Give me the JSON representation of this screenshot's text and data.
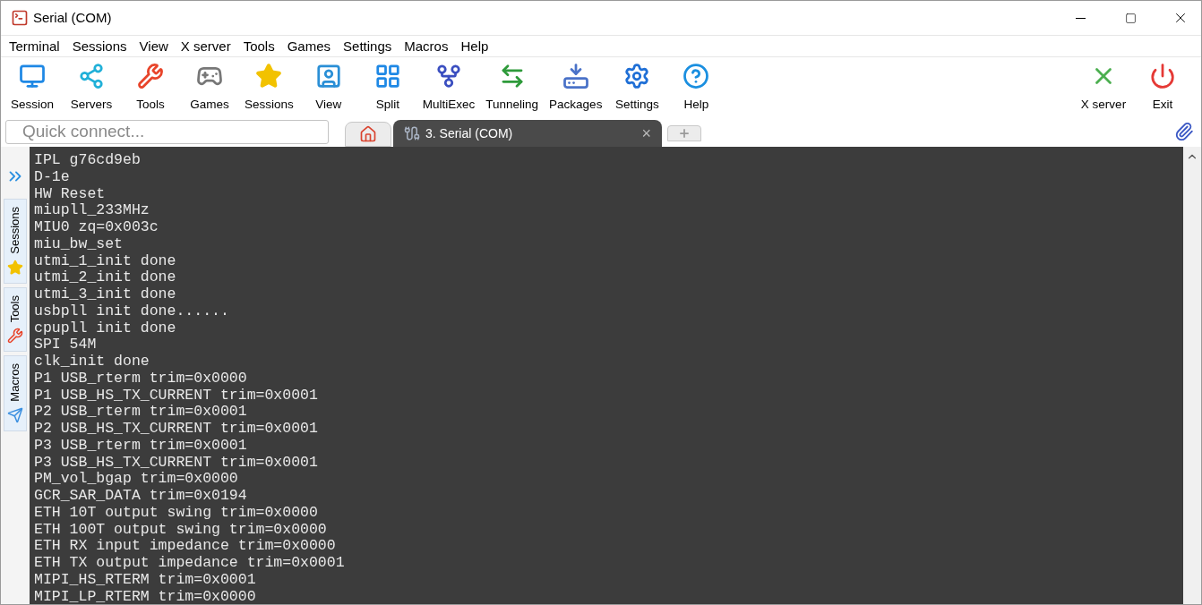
{
  "window": {
    "title": "Serial (COM)"
  },
  "menu": [
    "Terminal",
    "Sessions",
    "View",
    "X server",
    "Tools",
    "Games",
    "Settings",
    "Macros",
    "Help"
  ],
  "toolbar": [
    {
      "label": "Session",
      "kind": "session"
    },
    {
      "label": "Servers",
      "kind": "servers"
    },
    {
      "label": "Tools",
      "kind": "tools"
    },
    {
      "label": "Games",
      "kind": "games"
    },
    {
      "label": "Sessions",
      "kind": "sessions"
    },
    {
      "label": "View",
      "kind": "view"
    },
    {
      "label": "Split",
      "kind": "split"
    },
    {
      "label": "MultiExec",
      "kind": "multiexec"
    },
    {
      "label": "Tunneling",
      "kind": "tunneling"
    },
    {
      "label": "Packages",
      "kind": "packages"
    },
    {
      "label": "Settings",
      "kind": "settings"
    },
    {
      "label": "Help",
      "kind": "help"
    }
  ],
  "toolbar_right": [
    {
      "label": "X server",
      "kind": "xserver"
    },
    {
      "label": "Exit",
      "kind": "exit"
    }
  ],
  "quick_connect": {
    "placeholder": "Quick connect..."
  },
  "tabs": [
    {
      "kind": "home",
      "selected": false
    },
    {
      "kind": "session",
      "label": "3. Serial (COM)",
      "close": "×",
      "selected": true
    },
    {
      "kind": "new",
      "selected": false
    }
  ],
  "side_tabs": [
    {
      "label": "Sessions",
      "kind": "star"
    },
    {
      "label": "Tools",
      "kind": "tools"
    },
    {
      "label": "Macros",
      "kind": "plane"
    }
  ],
  "terminal_lines": [
    "IPL g76cd9eb",
    "D-1e",
    "HW Reset",
    "miupll_233MHz",
    "MIU0 zq=0x003c",
    "miu_bw_set",
    "utmi_1_init done",
    "utmi_2_init done",
    "utmi_3_init done",
    "usbpll init done......",
    "cpupll init done",
    "SPI 54M",
    "clk_init done",
    "P1 USB_rterm trim=0x0000",
    "P1 USB_HS_TX_CURRENT trim=0x0001",
    "P2 USB_rterm trim=0x0001",
    "P2 USB_HS_TX_CURRENT trim=0x0001",
    "P3 USB_rterm trim=0x0001",
    "P3 USB_HS_TX_CURRENT trim=0x0001",
    "PM_vol_bgap trim=0x0000",
    "GCR_SAR_DATA trim=0x0194",
    "ETH 10T output swing trim=0x0000",
    "ETH 100T output swing trim=0x0000",
    "ETH RX input impedance trim=0x0000",
    "ETH TX output impedance trim=0x0001",
    "MIPI_HS_RTERM trim=0x0001",
    "MIPI_LP_RTERM trim=0x0000"
  ]
}
